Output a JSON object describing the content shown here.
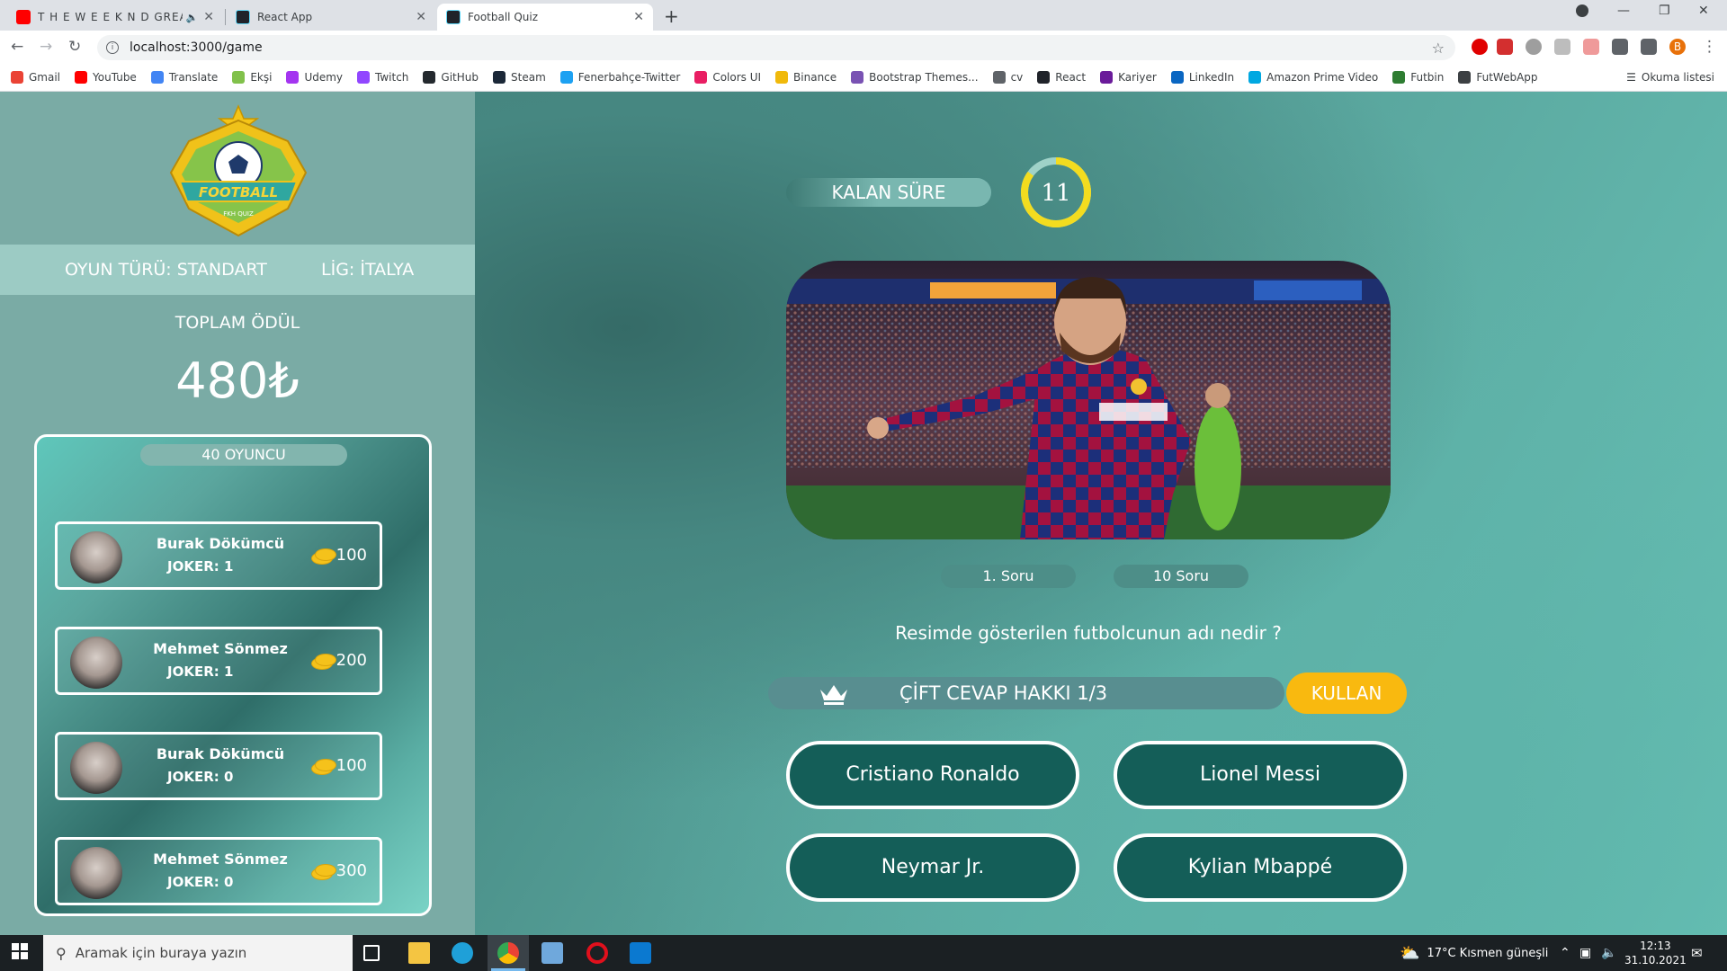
{
  "browser": {
    "tabs": [
      {
        "title": "T H E W E E K N D GREATEST",
        "active": false,
        "icon": "youtube-icon"
      },
      {
        "title": "React App",
        "active": false,
        "icon": "react-icon"
      },
      {
        "title": "Football Quiz",
        "active": true,
        "icon": "react-icon"
      }
    ],
    "url": "localhost:3000/game",
    "profile_initial": "B",
    "bookmarks": [
      {
        "label": "Gmail",
        "color": "#ea4335"
      },
      {
        "label": "YouTube",
        "color": "#ff0000"
      },
      {
        "label": "Translate",
        "color": "#4285f4"
      },
      {
        "label": "Ekşi",
        "color": "#81c14b"
      },
      {
        "label": "Udemy",
        "color": "#a435f0"
      },
      {
        "label": "Twitch",
        "color": "#9146ff"
      },
      {
        "label": "GitHub",
        "color": "#24292e"
      },
      {
        "label": "Steam",
        "color": "#1b2838"
      },
      {
        "label": "Fenerbahçe-Twitter",
        "color": "#1da1f2"
      },
      {
        "label": "Colors UI",
        "color": "#e91e63"
      },
      {
        "label": "Binance",
        "color": "#f0b90b"
      },
      {
        "label": "Bootstrap Themes...",
        "color": "#7952b3"
      },
      {
        "label": "cv",
        "color": "#5f6368"
      },
      {
        "label": "React",
        "color": "#20232a"
      },
      {
        "label": "Kariyer",
        "color": "#6a1b9a"
      },
      {
        "label": "LinkedIn",
        "color": "#0a66c2"
      },
      {
        "label": "Amazon Prime Video",
        "color": "#00a8e1"
      },
      {
        "label": "Futbin",
        "color": "#2e7d32"
      },
      {
        "label": "FutWebApp",
        "color": "#3c4043"
      }
    ],
    "reading_list": "Okuma listesi"
  },
  "sidebar": {
    "logo_text": "FOOTBALL",
    "logo_subtext": "FKH QUIZ",
    "game_type": "OYUN TÜRÜ: STANDART",
    "league": "LİG: İTALYA",
    "prize_label": "TOPLAM ÖDÜL",
    "prize_value": "480₺",
    "players_count": "40 OYUNCU",
    "players": [
      {
        "name": "Burak Dökümcü",
        "joker": "JOKER: 1",
        "score": "100"
      },
      {
        "name": "Mehmet Sönmez",
        "joker": "JOKER: 1",
        "score": "200"
      },
      {
        "name": "Burak Dökümcü",
        "joker": "JOKER: 0",
        "score": "100"
      },
      {
        "name": "Mehmet Sönmez",
        "joker": "JOKER: 0",
        "score": "300"
      }
    ]
  },
  "game": {
    "timer_label": "KALAN SÜRE",
    "timer_value": "11",
    "timer_fraction": 0.85,
    "question_number": "1. Soru",
    "total_questions": "10 Soru",
    "question": "Resimde gösterilen futbolcunun adı nedir ?",
    "joker_label": "ÇİFT CEVAP HAKKI 1/3",
    "use_button": "KULLAN",
    "answers": [
      "Cristiano Ronaldo",
      "Lionel Messi",
      "Neymar Jr.",
      "Kylian Mbappé"
    ]
  },
  "colors": {
    "sidebar_bg": "#7aaba5",
    "accent_yellow": "#f9b90f",
    "answer_bg": "#145e58"
  },
  "taskbar": {
    "search_placeholder": "Aramak için buraya yazın",
    "weather": "17°C  Kısmen güneşli",
    "time": "12:13",
    "date": "31.10.2021"
  }
}
